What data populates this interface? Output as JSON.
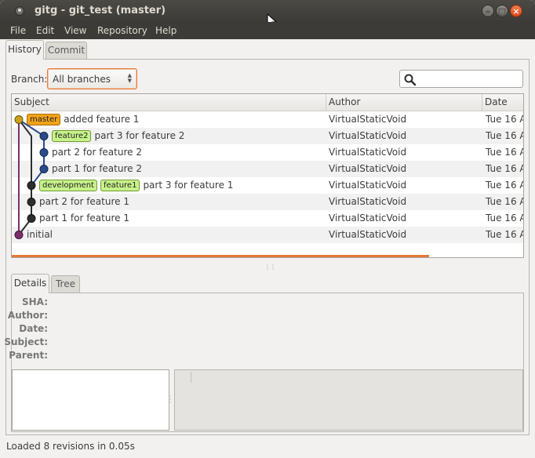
{
  "window": {
    "title": "gitg - git_test (master)"
  },
  "menu": [
    "File",
    "Edit",
    "View",
    "Repository",
    "Help"
  ],
  "top_tabs": [
    "History",
    "Commit"
  ],
  "branch": {
    "label": "Branch:",
    "value": "All branches"
  },
  "table": {
    "columns": [
      "Subject",
      "Author",
      "Date"
    ],
    "rows": [
      {
        "tags": [
          {
            "label": "master",
            "kind": "master"
          }
        ],
        "subject": "added feature 1",
        "author": "VirtualStaticVoid",
        "date": "Tue 16 A"
      },
      {
        "tags": [
          {
            "label": "feature2",
            "kind": "feature"
          }
        ],
        "subject": "part 3 for feature 2",
        "author": "VirtualStaticVoid",
        "date": "Tue 16 A"
      },
      {
        "tags": [],
        "subject": "part 2 for feature 2",
        "author": "VirtualStaticVoid",
        "date": "Tue 16 A"
      },
      {
        "tags": [],
        "subject": "part 1 for feature 2",
        "author": "VirtualStaticVoid",
        "date": "Tue 16 A"
      },
      {
        "tags": [
          {
            "label": "development",
            "kind": "feature"
          },
          {
            "label": "feature1",
            "kind": "feature"
          }
        ],
        "subject": "part 3 for feature 1",
        "author": "VirtualStaticVoid",
        "date": "Tue 16 A"
      },
      {
        "tags": [],
        "subject": "part 2 for feature 1",
        "author": "VirtualStaticVoid",
        "date": "Tue 16 A"
      },
      {
        "tags": [],
        "subject": "part 1 for feature 1",
        "author": "VirtualStaticVoid",
        "date": "Tue 16 A"
      },
      {
        "tags": [],
        "subject": "initial",
        "author": "VirtualStaticVoid",
        "date": "Tue 16 A"
      }
    ]
  },
  "bottom_tabs": [
    "Details",
    "Tree"
  ],
  "details": {
    "labels": [
      "SHA:",
      "Author:",
      "Date:",
      "Subject:",
      "Parent:"
    ]
  },
  "status": "Loaded 8 revisions in 0.05s",
  "colors": {
    "accent": "#e8783a",
    "master_tag": "#f2a319",
    "branch_tag": "#c7f28a",
    "lane_gold": "#c9a01b",
    "lane_blue": "#2a4b8c",
    "lane_dark": "#2e2e2e",
    "lane_purple": "#7a2f6a"
  }
}
